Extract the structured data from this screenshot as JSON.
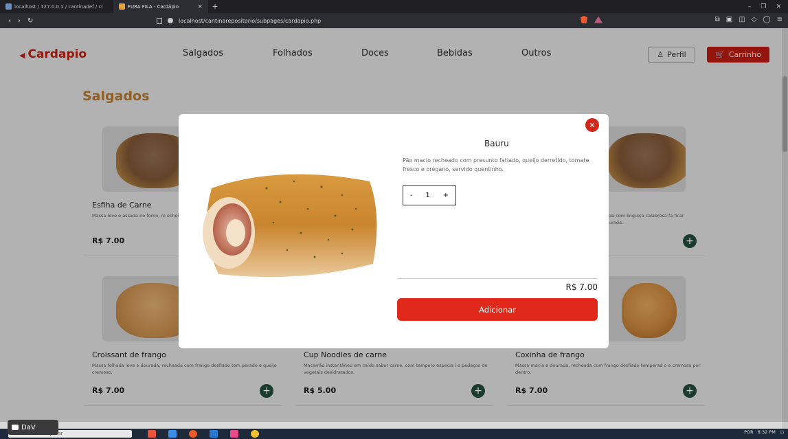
{
  "browser": {
    "tabs": [
      {
        "title": "localhost / 127.0.0.1 / cantinadef / cl",
        "active": false
      },
      {
        "title": "FURA FILA - Cardápio",
        "active": true
      }
    ],
    "url": "localhost/cantinarepositorio/subpages/cardapio.php"
  },
  "nav": {
    "brand": "Cardapio",
    "menu": [
      "Salgados",
      "Folhados",
      "Doces",
      "Bebidas",
      "Outros"
    ],
    "perfil": "Perfil",
    "carrinho": "Carrinho"
  },
  "category_title": "Salgados",
  "products": [
    {
      "name": "Esfiha de Carne",
      "desc": "Massa leve e assada no forno, re echeio de carne moída tempera",
      "price": "R$ 7.00"
    },
    {
      "name": "",
      "desc": "eada com linguiça calabresa fa ficar dourada.",
      "price": ""
    },
    {
      "name": "Croissant de frango",
      "desc": "Massa folhada leve e dourada, recheada com frango desfiado tem perado e queijo cremoso.",
      "price": "R$ 7.00"
    },
    {
      "name": "Cup Noodles de carne",
      "desc": "Macarrão instantâneo em caldo sabor carne, com tempero especia l e pedaços de vegetais desidratados.",
      "price": "R$ 5.00"
    },
    {
      "name": "Coxinha de frango",
      "desc": "Massa macia e dourada, recheada com frango desfiado temperad o e cremosa por dentro.",
      "price": "R$ 7.00"
    }
  ],
  "modal": {
    "title": "Bauru",
    "description": "Pão macio recheado com presunto fatiado, queijo derretido, tomate fresco e orégano, servido quentinho.",
    "quantity": "1",
    "minus": "-",
    "plus": "+",
    "price": "R$ 7.00",
    "add_label": "Adicionar",
    "close": "✕"
  },
  "taskbar": {
    "search_placeholder": "Pesquisar",
    "lang": "POR",
    "time": "6:32 PM",
    "overlay_label": "DaV"
  }
}
